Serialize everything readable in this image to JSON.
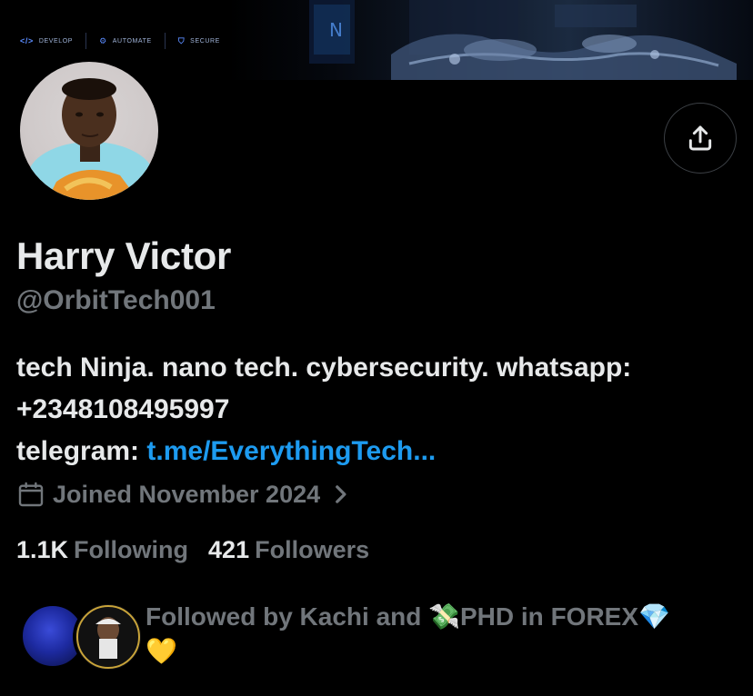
{
  "banner": {
    "tags": [
      {
        "icon": "</>",
        "label": "DEVELOP"
      },
      {
        "icon": "⚙",
        "label": "AUTOMATE"
      },
      {
        "icon": "⛉",
        "label": "SECURE"
      }
    ]
  },
  "profile": {
    "name": "Harry Victor",
    "handle": "@OrbitTech001",
    "bio_line1": "tech Ninja. nano tech. cybersecurity. whatsapp:",
    "bio_line2": "+2348108495997",
    "bio_line3_prefix": "telegram: ",
    "bio_link": "t.me/EverythingTech...",
    "joined": "Joined November 2024"
  },
  "stats": {
    "following_count": "1.1K",
    "following_label": "Following",
    "followers_count": "421",
    "followers_label": "Followers"
  },
  "followed_by": {
    "text": "Followed by Kachi and 💸PHD in FOREX💎",
    "text2": "💛"
  },
  "icons": {
    "share": "share-icon",
    "calendar": "calendar-icon",
    "chevron": "chevron-right-icon"
  },
  "colors": {
    "background": "#000000",
    "primary_text": "#e7e9ea",
    "secondary_text": "#71767b",
    "link": "#1d9bf0"
  }
}
